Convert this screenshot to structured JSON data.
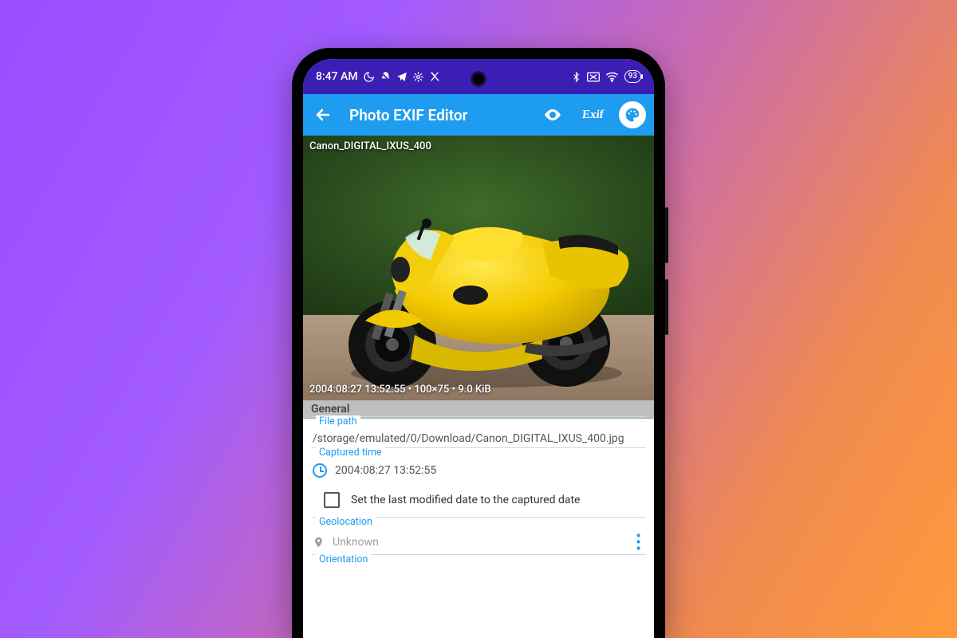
{
  "status_bar": {
    "time": "8:47 AM",
    "battery": "93"
  },
  "app_bar": {
    "title": "Photo EXIF Editor",
    "exif_label": "Exif"
  },
  "photo": {
    "camera_model": "Canon_DIGITAL_IXUS_400",
    "meta_line": "2004:08:27 13:52:55 • 100×75 • 9.0 KiB"
  },
  "sections": {
    "general": "General"
  },
  "fields": {
    "file_path": {
      "label": "File path",
      "value": "/storage/emulated/0/Download/Canon_DIGITAL_IXUS_400.jpg"
    },
    "captured_time": {
      "label": "Captured time",
      "value": "2004:08:27 13:52:55",
      "checkbox_label": "Set the last modified date to the captured date"
    },
    "geolocation": {
      "label": "Geolocation",
      "value": "Unknown"
    },
    "orientation": {
      "label": "Orientation"
    }
  }
}
